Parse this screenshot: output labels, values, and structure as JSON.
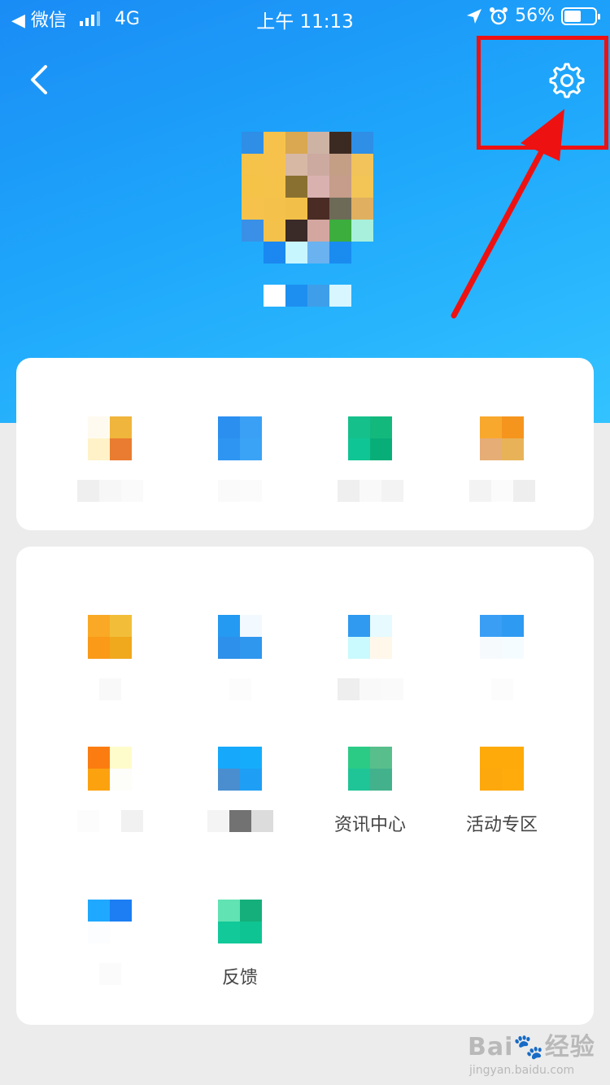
{
  "status_bar": {
    "back_app": "◀ 微信",
    "network": "4G",
    "time": "上午 11:13",
    "battery": "56%",
    "battery_level": 0.56
  },
  "nav": {
    "back_icon": "chevron-left-icon",
    "settings_icon": "gear-icon"
  },
  "colors": {
    "hero_start": "#1a8cf5",
    "hero_end": "#33c3ff",
    "annotation_red": "#ee1111"
  },
  "grid_labels": {
    "news_center": "资讯中心",
    "activity_zone": "活动专区",
    "feedback": "反馈"
  },
  "watermark": {
    "brand": "Bai",
    "brand_tail": "经验",
    "url": "jingyan.baidu.com"
  }
}
